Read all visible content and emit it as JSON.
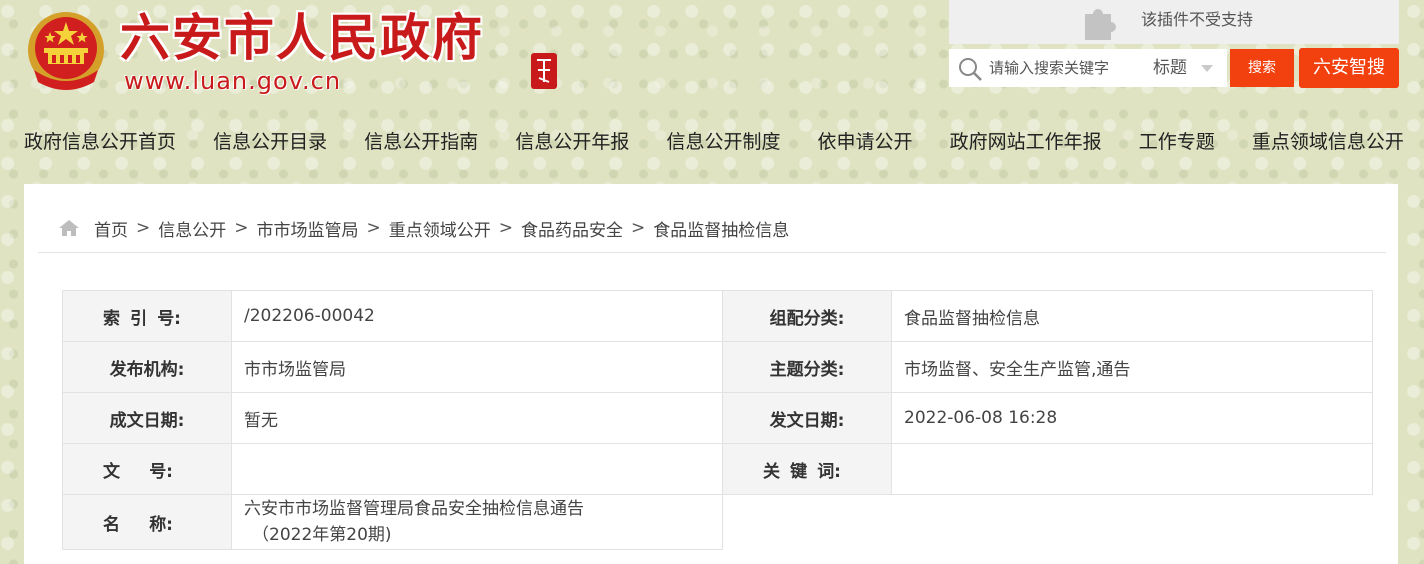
{
  "header": {
    "site_title": "六安市人民政府",
    "site_url": "www.luan.gov.cn",
    "plugin_notice": "该插件不受支持",
    "search": {
      "placeholder": "请输入搜索关键字",
      "scope": "标题",
      "search_label": "搜索",
      "zhisou_label": "六安智搜"
    }
  },
  "nav": {
    "items": [
      "政府信息公开首页",
      "信息公开目录",
      "信息公开指南",
      "信息公开年报",
      "信息公开制度",
      "依申请公开",
      "政府网站工作年报",
      "工作专题",
      "重点领域信息公开"
    ]
  },
  "breadcrumb": [
    "首页",
    "信息公开",
    "市市场监管局",
    "重点领域公开",
    "食品药品安全",
    "食品监督抽检信息"
  ],
  "breadcrumb_separator": ">",
  "info": {
    "index_no": {
      "label_chars": [
        "索",
        "引",
        "号:"
      ],
      "value": "/202206-00042"
    },
    "category": {
      "label": "组配分类:",
      "value": "食品监督抽检信息"
    },
    "publisher": {
      "label": "发布机构:",
      "value": "市市场监管局"
    },
    "topic": {
      "label": "主题分类:",
      "value": "市场监督、安全生产监管,通告"
    },
    "created_date": {
      "label": "成文日期:",
      "value": "暂无"
    },
    "issue_date": {
      "label": "发文日期:",
      "value": "2022-06-08 16:28"
    },
    "doc_no": {
      "label_chars": [
        "文",
        "号:"
      ],
      "value": ""
    },
    "keywords": {
      "label_chars": [
        "关",
        "键",
        "词:"
      ],
      "value": ""
    },
    "name": {
      "label_chars": [
        "名",
        "称:"
      ],
      "value_line1": "六安市市场监督管理局食品安全抽检信息通告",
      "value_line2": "（2022年第20期)"
    }
  },
  "colors": {
    "accent": "#f2400f",
    "title_red": "#c81a1a",
    "background": "#dfe3c2"
  }
}
